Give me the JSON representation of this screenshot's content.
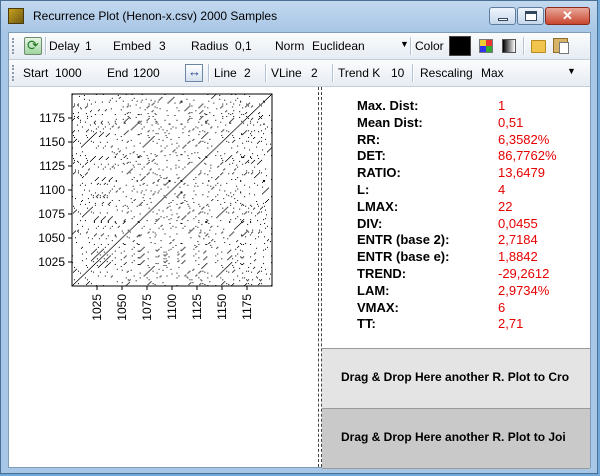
{
  "window": {
    "title": "Recurrence Plot (Henon-x.csv) 2000 Samples"
  },
  "toolbar1": {
    "delay_label": "Delay",
    "delay_value": "1",
    "embed_label": "Embed",
    "embed_value": "3",
    "radius_label": "Radius",
    "radius_value": "0,1",
    "norm_label": "Norm",
    "norm_value": "Euclidean",
    "color_label": "Color",
    "color_value": "#000000",
    "icons": [
      "refresh-icon",
      "palette-icon",
      "gradient-icon",
      "folder-icon",
      "clipboard-icon"
    ]
  },
  "toolbar2": {
    "start_label": "Start",
    "start_value": "1000",
    "end_label": "End",
    "end_value": "1200",
    "line_label": "Line",
    "line_value": "2",
    "vline_label": "VLine",
    "vline_value": "2",
    "trendk_label": "Trend K",
    "trendk_value": "10",
    "rescaling_label": "Rescaling",
    "rescaling_value": "Max"
  },
  "stats": [
    {
      "label": "Max. Dist:",
      "value": "1"
    },
    {
      "label": "Mean Dist:",
      "value": "0,51"
    },
    {
      "label": "RR:",
      "value": "6,3582%"
    },
    {
      "label": "DET:",
      "value": "86,7762%"
    },
    {
      "label": "RATIO:",
      "value": "13,6479"
    },
    {
      "label": "L:",
      "value": "4"
    },
    {
      "label": "LMAX:",
      "value": "22"
    },
    {
      "label": "DIV:",
      "value": "0,0455"
    },
    {
      "label": "ENTR (base 2):",
      "value": "2,7184"
    },
    {
      "label": "ENTR (base e):",
      "value": "1,8842"
    },
    {
      "label": "TREND:",
      "value": "-29,2612"
    },
    {
      "label": "LAM:",
      "value": "2,9734%"
    },
    {
      "label": "VMAX:",
      "value": "6"
    },
    {
      "label": "TT:",
      "value": "2,71"
    }
  ],
  "dropzones": [
    {
      "label": "Drag & Drop Here another R. Plot to Cro"
    },
    {
      "label": "Drag & Drop Here another R. Plot to Joi"
    }
  ],
  "plot": {
    "y_ticks": [
      "1175",
      "1150",
      "1125",
      "1100",
      "1075",
      "1050",
      "1025"
    ],
    "x_ticks": [
      "1025",
      "1050",
      "1075",
      "1100",
      "1125",
      "1150",
      "1175"
    ],
    "range": [
      1000,
      1200
    ],
    "point_color": "#000000",
    "background": "#ffffff"
  },
  "colors": {
    "stat_value": "#e60000",
    "title_bar": "#a8c6e6",
    "close_button": "#c9462f"
  }
}
